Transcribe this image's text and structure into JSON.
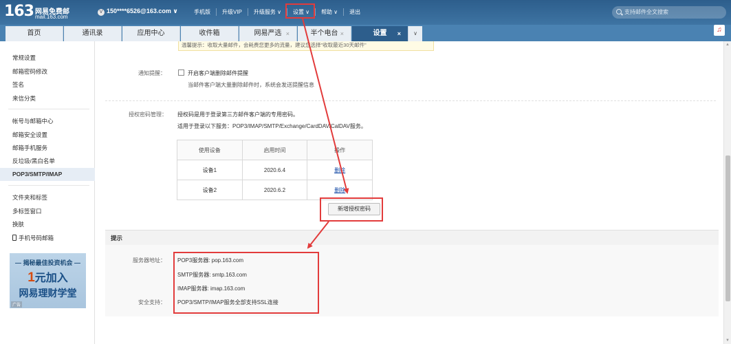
{
  "header": {
    "logo_number": "163",
    "logo_line1": "网易免费邮",
    "logo_line2": "mail.163.com",
    "account_badge": "V",
    "account": "150****6526@163.com ∨",
    "links": [
      "手机版",
      "升级VIP",
      "升级服务 ∨",
      "设置 ∨",
      "帮助 ∨",
      "退出"
    ],
    "search_placeholder": "支持邮件全文搜索"
  },
  "tabs": [
    {
      "label": "首页"
    },
    {
      "label": "通讯录"
    },
    {
      "label": "应用中心"
    },
    {
      "label": "收件箱"
    },
    {
      "label": "网易严选",
      "close": "×"
    },
    {
      "label": "半个电台",
      "close": "×"
    },
    {
      "label": "设置",
      "close": "×"
    }
  ],
  "tab_more": "∨",
  "music_icon": "♫",
  "sidebar": {
    "group1": [
      "常规设置",
      "邮箱密码修改",
      "签名",
      "来信分类"
    ],
    "group2": [
      "帐号与邮箱中心",
      "邮箱安全设置",
      "邮箱手机服务",
      "反垃圾/黑白名单",
      "POP3/SMTP/IMAP"
    ],
    "group3": [
      "文件夹和标签",
      "多标签窗口",
      "换肤",
      "手机号码邮箱"
    ],
    "ad": {
      "line1": "— 揭秘最佳投资机会 —",
      "line2_big": "1",
      "line2_rest": "元加入",
      "line3": "网易理财学堂",
      "tag": "广告"
    }
  },
  "main": {
    "notice": "温馨提示：收取大量邮件，会耗费您更多的流量，建议您选择\"收取最近30天邮件\"",
    "notify_label": "通知提醒：",
    "notify_checkbox": "开启客户端删除邮件提醒",
    "notify_desc": "当邮件客户端大量删除邮件时，系统会发送提醒信息",
    "auth_label": "授权密码管理：",
    "auth_desc1": "授权码是用于登录第三方邮件客户端的专用密码。",
    "auth_desc2": "适用于登录以下服务：POP3/IMAP/SMTP/Exchange/CardDAV/CalDAV服务。",
    "table_headers": [
      "使用设备",
      "启用时间",
      "操作"
    ],
    "table_rows": [
      {
        "device": "设备1",
        "date": "2020.6.4",
        "action": "删除"
      },
      {
        "device": "设备2",
        "date": "2020.6.2",
        "action": "删除"
      }
    ],
    "add_button": "新增授权密码",
    "tips_title": "提示",
    "server_label": "服务器地址：",
    "pop3": "POP3服务器: pop.163.com",
    "smtp": "SMTP服务器: smtp.163.com",
    "imap": "IMAP服务器: imap.163.com",
    "security_label": "安全支持：",
    "security": "POP3/SMTP/IMAP服务全部支持SSL连接"
  },
  "colors": {
    "header": "#2d5e8c",
    "highlight": "#e23b3b",
    "link": "#1b4fa8"
  }
}
